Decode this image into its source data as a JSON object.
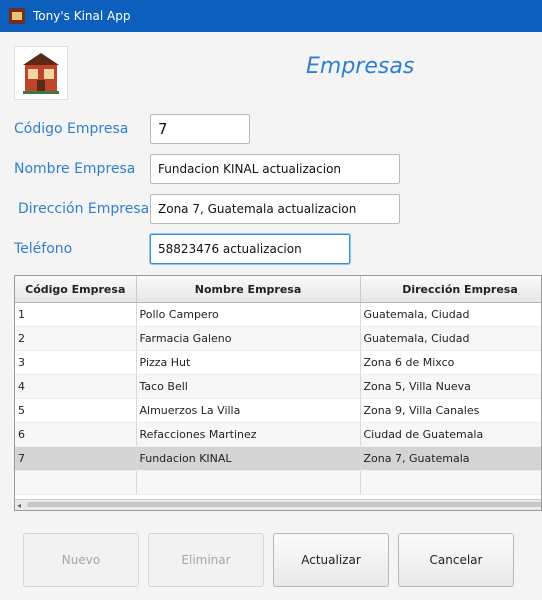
{
  "window": {
    "title": "Tony's Kinal App"
  },
  "logo": {
    "name": "restaurant-logo"
  },
  "header": {
    "title": "Empresas"
  },
  "form": {
    "codigo": {
      "label": "Código Empresa",
      "value": "7"
    },
    "nombre": {
      "label": "Nombre Empresa",
      "value": "Fundacion KINAL actualizacion"
    },
    "direccion": {
      "label": "Dirección Empresa",
      "value": "Zona 7, Guatemala actualizacion"
    },
    "telefono": {
      "label": "Teléfono",
      "value": "58823476 actualizacion"
    }
  },
  "table": {
    "columns": [
      "Código Empresa",
      "Nombre Empresa",
      "Dirección Empresa"
    ],
    "rows": [
      [
        "1",
        "Pollo Campero",
        "Guatemala, Ciudad"
      ],
      [
        "2",
        "Farmacia Galeno",
        "Guatemala, Ciudad"
      ],
      [
        "3",
        "Pizza Hut",
        "Zona 6 de Mixco"
      ],
      [
        "4",
        "Taco Bell",
        "Zona 5, Villa Nueva"
      ],
      [
        "5",
        "Almuerzos La Villa",
        "Zona 9, Villa Canales"
      ],
      [
        "6",
        "Refacciones Martinez",
        "Ciudad de Guatemala"
      ],
      [
        "7",
        "Fundacion KINAL",
        "Zona 7, Guatemala"
      ]
    ],
    "selected_row": "7"
  },
  "buttons": {
    "nuevo": "Nuevo",
    "eliminar": "Eliminar",
    "actualizar": "Actualizar",
    "cancelar": "Cancelar"
  },
  "colors": {
    "titlebar": "#0c5fbd",
    "label_accent": "#2f7fd0",
    "focus_border": "#3b8fe0"
  }
}
